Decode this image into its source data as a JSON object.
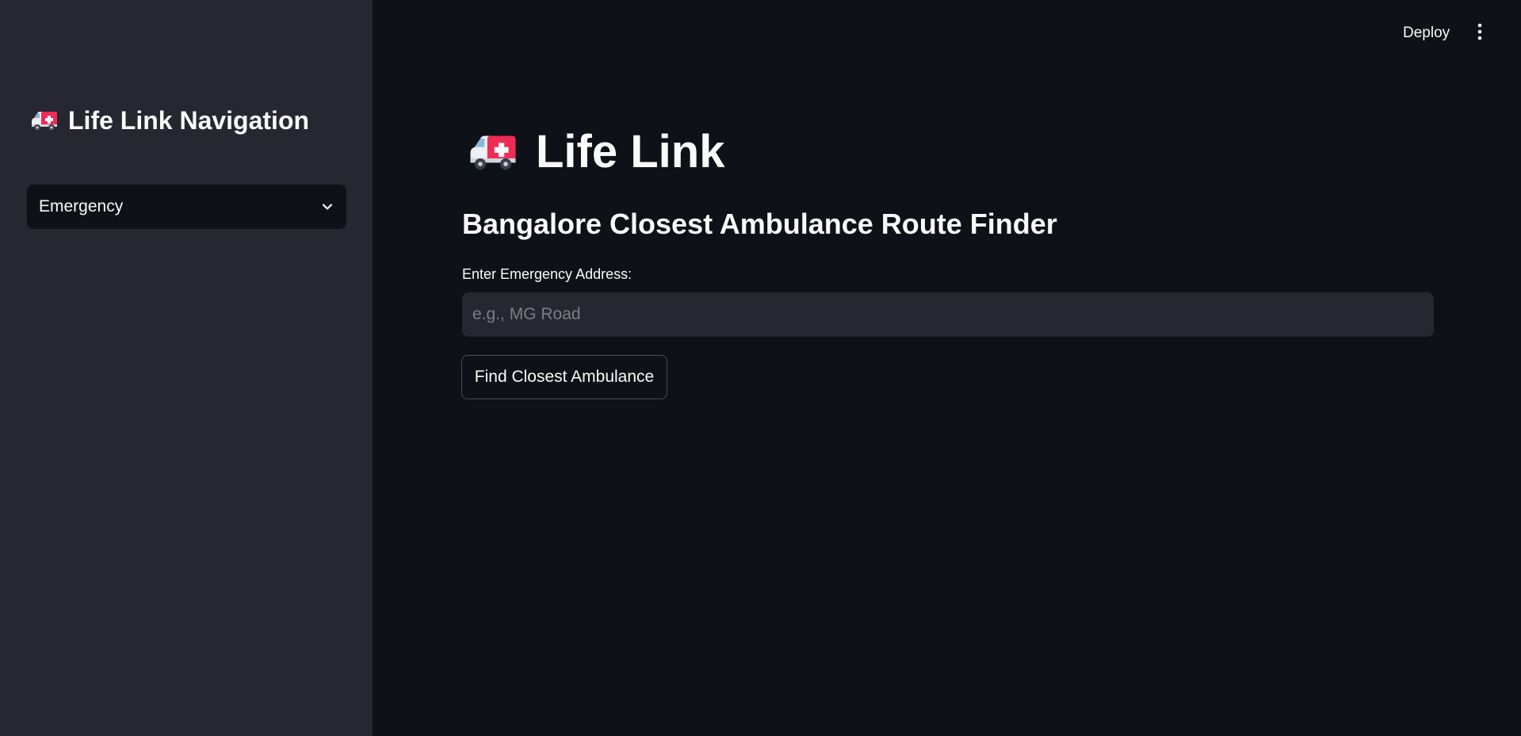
{
  "sidebar": {
    "title": "Life Link Navigation",
    "title_icon": "ambulance-icon",
    "page_select": {
      "selected": "Emergency",
      "icon": "chevron-down-icon"
    }
  },
  "header": {
    "deploy_label": "Deploy",
    "menu_icon": "more-vertical-icon"
  },
  "main": {
    "title": "Life Link",
    "title_icon": "ambulance-icon",
    "subheader": "Bangalore Closest Ambulance Route Finder",
    "address_label": "Enter Emergency Address:",
    "address_value": "",
    "address_placeholder": "e.g., MG Road",
    "find_button_label": "Find Closest Ambulance"
  },
  "colors": {
    "main_background": "#0e1117",
    "sidebar_background": "#262730",
    "input_background": "#262730",
    "text": "#fafafa",
    "ambulance_red": "#ee2a55"
  }
}
